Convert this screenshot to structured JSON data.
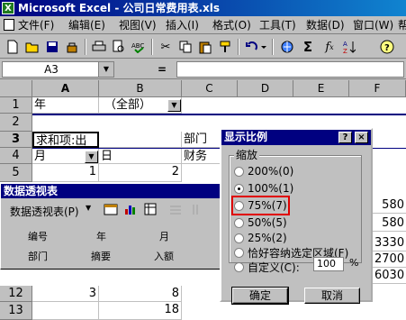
{
  "window": {
    "title": "Microsoft Excel - 公司日常费用表.xls",
    "icon": "excel-icon"
  },
  "menu": [
    "文件(F)",
    "编辑(E)",
    "视图(V)",
    "插入(I)",
    "格式(O)",
    "工具(T)",
    "数据(D)",
    "窗口(W)",
    "帮"
  ],
  "toolbar": {
    "icons": [
      "new-icon",
      "open-icon",
      "save-icon",
      "permission-icon",
      "print-icon",
      "print-preview-icon",
      "spellcheck-icon",
      "cut-icon",
      "copy-icon",
      "paste-icon",
      "format-painter-icon",
      "undo-icon",
      "hyperlink-icon",
      "autosum-icon",
      "function-icon",
      "sort-ascending-icon",
      "help-icon"
    ]
  },
  "formula_bar": {
    "name_box": "A3",
    "equals": "=",
    "value": ""
  },
  "columns": [
    "A",
    "B",
    "C",
    "D",
    "E",
    "F"
  ],
  "rows": {
    "labels": [
      "1",
      "2",
      "3",
      "4",
      "5",
      "12",
      "13"
    ],
    "r1": {
      "a": "年",
      "b": "（全部）"
    },
    "r3": {
      "a": "求和项:出",
      "c": "部门"
    },
    "r4": {
      "a": "月",
      "b": "日",
      "c": "财务"
    },
    "r5": {
      "a": "1",
      "b": "2"
    },
    "r12": {
      "a": "3",
      "b": "8"
    },
    "r13": {
      "b": "18"
    },
    "right_values": [
      "580",
      "580",
      "3330",
      "2700",
      "6030"
    ]
  },
  "pivot_toolbar": {
    "title": "数据透视表",
    "menu_label": "数据透视表(P)",
    "fields_row1": [
      "编号",
      "年",
      "月"
    ],
    "fields_row2": [
      "部门",
      "摘要",
      "入额"
    ]
  },
  "zoom_dialog": {
    "title": "显示比例",
    "help": "?",
    "close": "×",
    "group_label": "缩放",
    "options": [
      "200%(0)",
      "100%(1)",
      "75%(7)",
      "50%(5)",
      "25%(2)",
      "恰好容纳选定区域(F)",
      "自定义(C):"
    ],
    "selected": "100%(1)",
    "highlighted": "75%(7)",
    "custom_value": "100",
    "percent": "%",
    "ok": "确定",
    "cancel": "取消"
  },
  "colors": {
    "title_bar": "#000080",
    "highlight": "#e00000",
    "face": "#c0c0c0"
  }
}
